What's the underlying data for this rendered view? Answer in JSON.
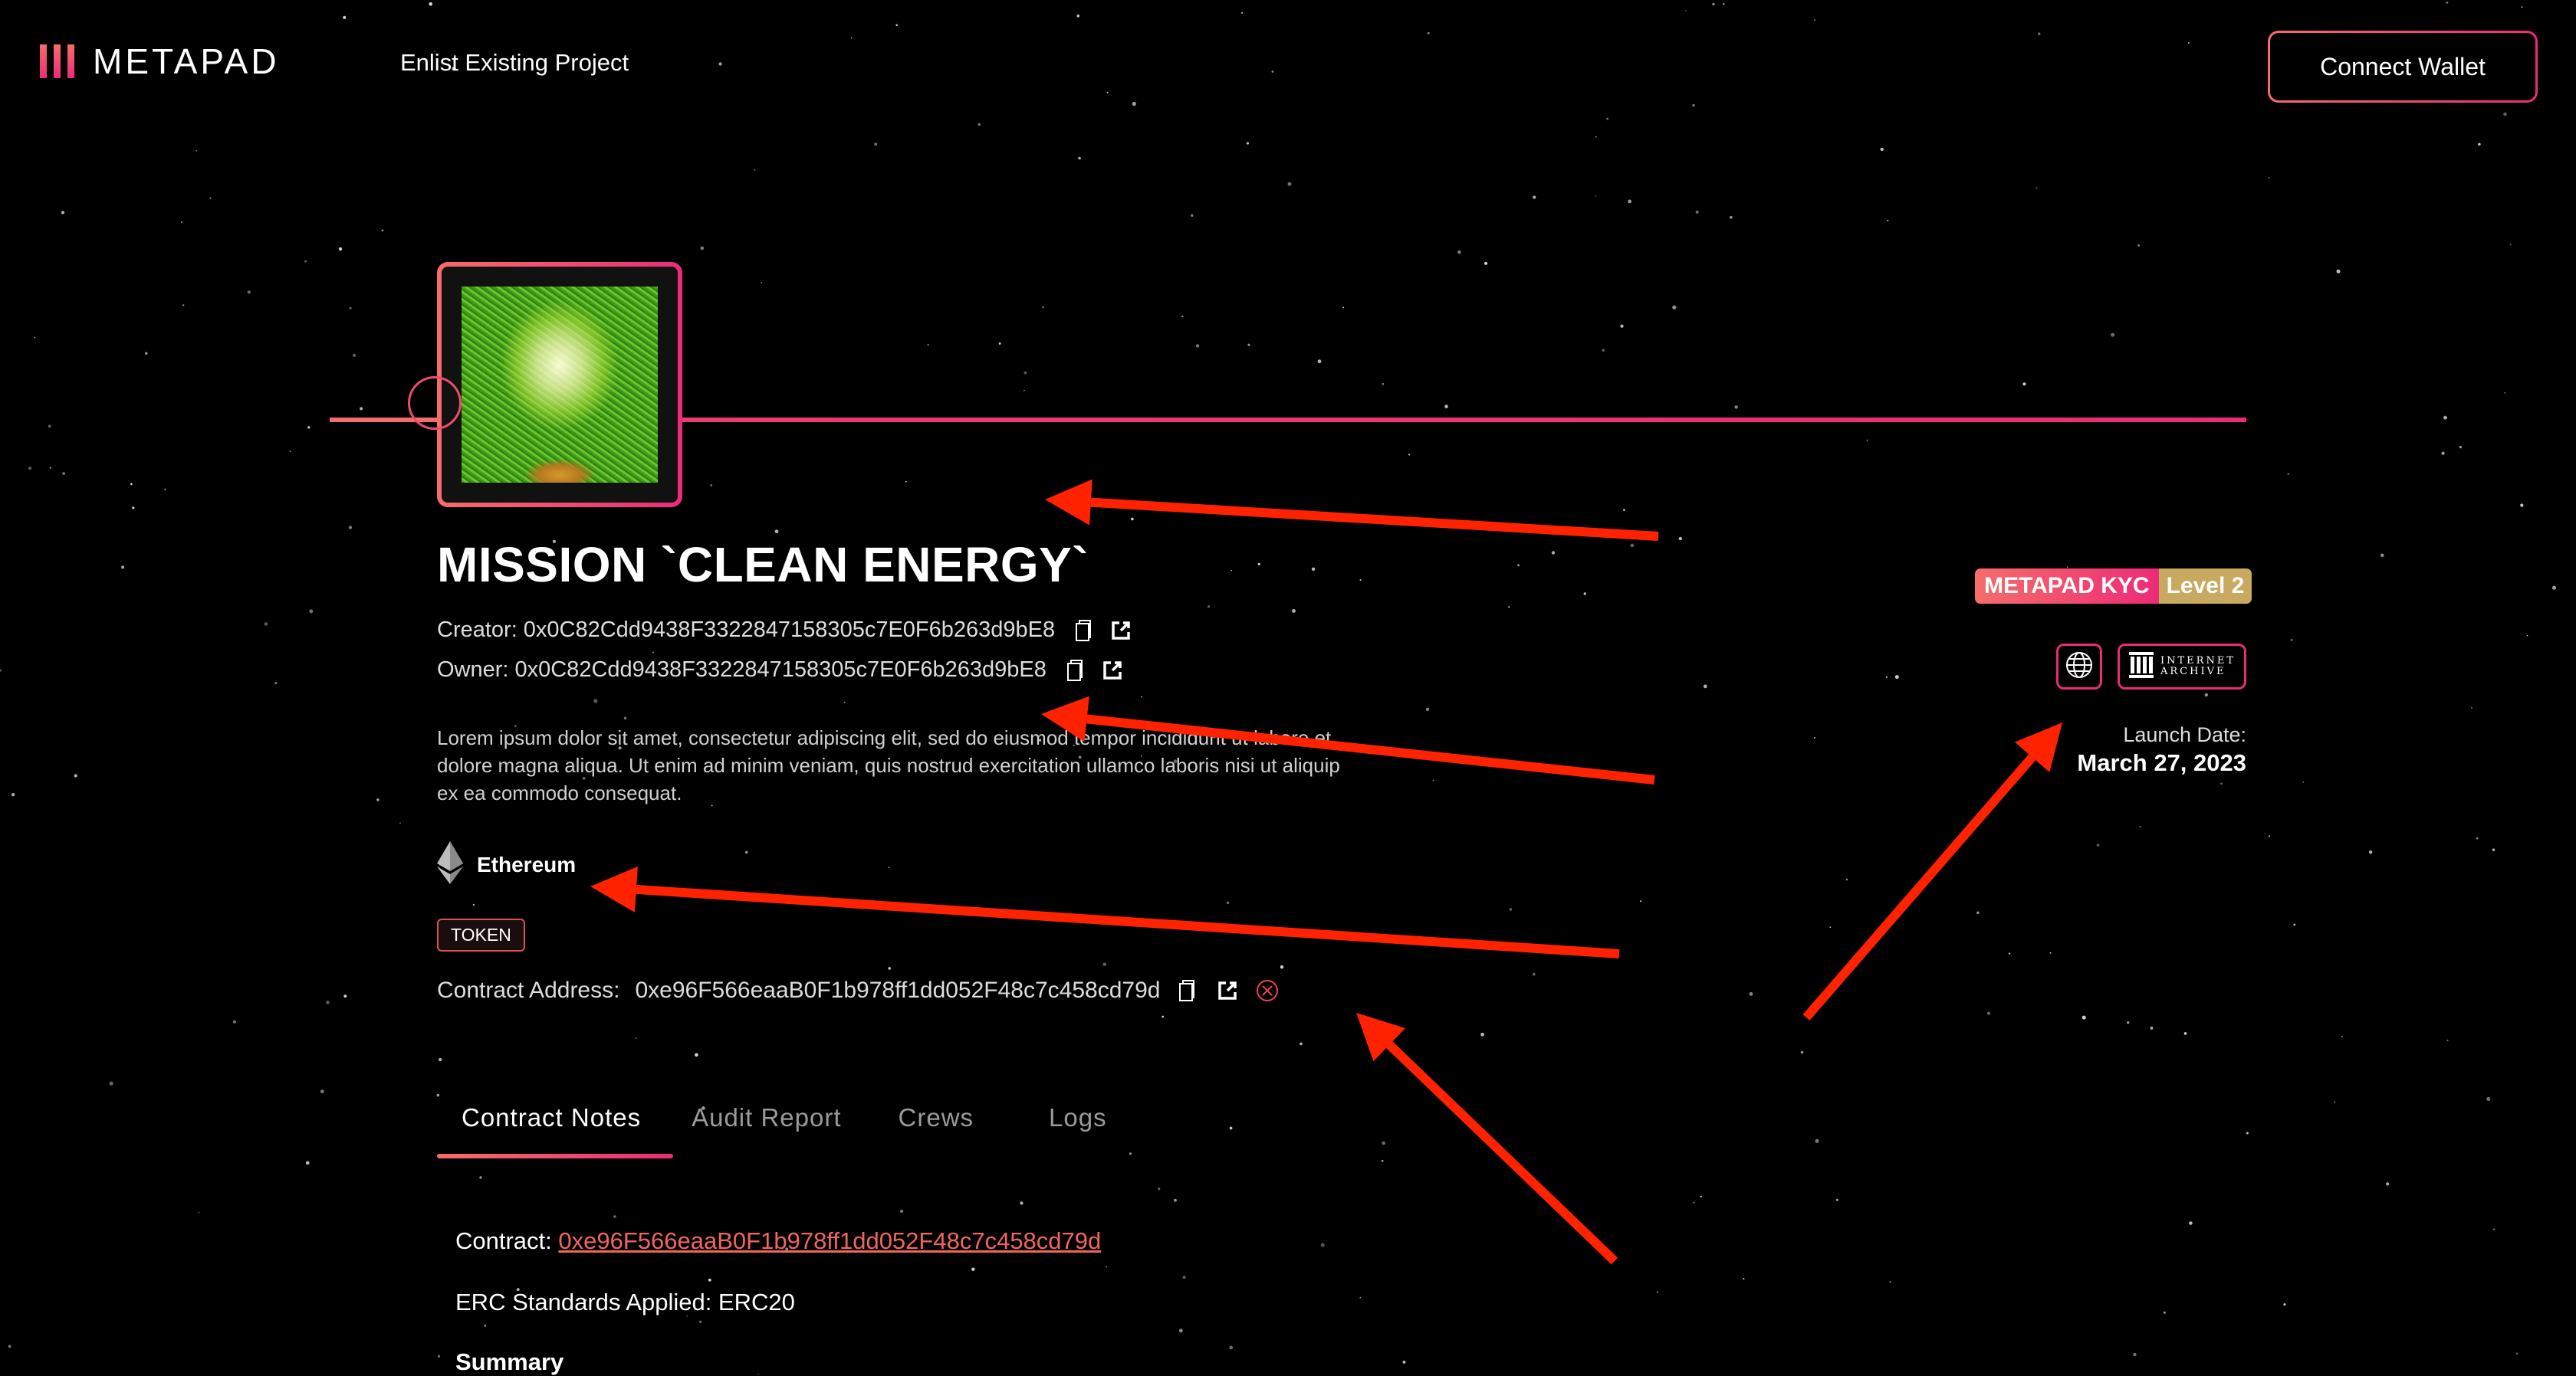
{
  "header": {
    "logo_text": "METAPAD",
    "nav_enlist": "Enlist Existing Project",
    "connect_wallet": "Connect Wallet"
  },
  "project": {
    "image_alt": "light bulb on grass",
    "title": "MISSION `CLEAN ENERGY`",
    "creator_label": "Creator:",
    "creator_address": "0x0C82Cdd9438F3322847158305c7E0F6b263d9bE8",
    "owner_label": "Owner:",
    "owner_address": "0x0C82Cdd9438F3322847158305c7E0F6b263d9bE8",
    "description": "Lorem ipsum dolor sit amet, consectetur adipiscing elit, sed do eiusmod tempor incididunt ut labore et dolore magna aliqua. Ut enim ad minim veniam, quis nostrud exercitation ullamco laboris nisi ut aliquip ex ea commodo consequat.",
    "chain": "Ethereum",
    "type_badge": "TOKEN",
    "contract_label": "Contract Address:",
    "contract_address": "0xe96F566eaaB0F1b978ff1dd052F48c7c458cd79d"
  },
  "kyc": {
    "label": "METAPAD KYC",
    "level": "Level 2"
  },
  "links": {
    "website_icon": "globe-icon",
    "archive_line1": "INTERNET",
    "archive_line2": "ARCHIVE"
  },
  "launch": {
    "label": "Launch Date:",
    "date": "March 27, 2023"
  },
  "tabs": [
    {
      "label": "Contract Notes",
      "active": true
    },
    {
      "label": "Audit Report",
      "active": false
    },
    {
      "label": "Crews",
      "active": false
    },
    {
      "label": "Logs",
      "active": false
    }
  ],
  "notes": {
    "contract_label": "Contract:",
    "contract_link": "0xe96F566eaaB0F1b978ff1dd052F48c7c458cd79d",
    "erc_line": "ERC Standards Applied: ERC20",
    "summary_heading": "Summary"
  },
  "colors": {
    "accent_start": "#f56d6a",
    "accent_end": "#ec2b78",
    "kyc_level": "#c9a860",
    "annotation_arrow": "#ff2200",
    "link": "#f0665f"
  }
}
